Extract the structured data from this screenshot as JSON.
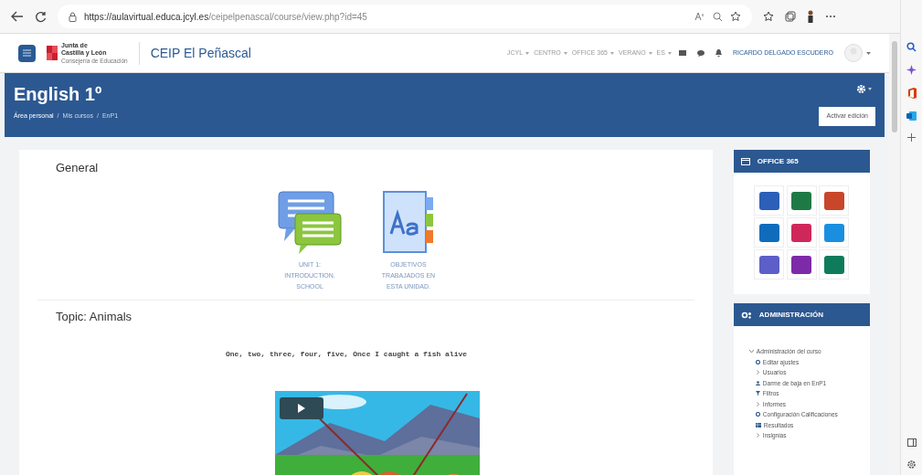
{
  "browser": {
    "url_host": "https://aulavirtual.educa.jcyl.es",
    "url_path": "/ceipelpenascal/course/view.php?id=45"
  },
  "header": {
    "logo_line1": "Junta de",
    "logo_line2": "Castilla y León",
    "logo_line3": "Consejería de Educación",
    "site_name": "CEIP El Peñascal",
    "menus": [
      "JCYL",
      "CENTRO",
      "OFFICE 365",
      "VERANO",
      "ES"
    ],
    "user_name": "RICARDO DELGADO ESCUDERO"
  },
  "course": {
    "title": "English 1º",
    "breadcrumbs": [
      "Área personal",
      "Mis cursos",
      "EnP1"
    ],
    "breadcrumb_separator": "/",
    "edit_button": "Activar edición"
  },
  "sections": [
    {
      "title": "General",
      "activities": [
        {
          "kind": "forum",
          "label": "UNIT 1: INTRODUCTION. SCHOOL"
        },
        {
          "kind": "glossary",
          "label": "OBJETIVOS TRABAJADOS EN ESTA UNIDAD."
        }
      ]
    },
    {
      "title": "Topic: Animals",
      "text": "One, two, three, four, five, Once I caught a fish alive"
    }
  ],
  "blocks": {
    "office": {
      "title": "OFFICE 365",
      "apps": [
        {
          "color": "#2b5fb8"
        },
        {
          "color": "#1e7a45"
        },
        {
          "color": "#c9462b"
        },
        {
          "color": "#0f6cbd"
        },
        {
          "color": "#d0275a"
        },
        {
          "color": "#1a8fe0"
        },
        {
          "color": "#5b5fc7"
        },
        {
          "color": "#7d2aa8"
        },
        {
          "color": "#0e7c5a"
        }
      ]
    },
    "admin": {
      "title": "ADMINISTRACIÓN",
      "tree": {
        "label": "Administración del curso",
        "expanded": true,
        "children": [
          {
            "kind": "gear",
            "label": "Editar ajustes"
          },
          {
            "kind": "branch",
            "label": "Usuarios"
          },
          {
            "kind": "user",
            "label": "Darme de baja en EnP1"
          },
          {
            "kind": "filter",
            "label": "Filtros"
          },
          {
            "kind": "branch",
            "label": "Informes"
          },
          {
            "kind": "gear",
            "label": "Configuración Calificaciones"
          },
          {
            "kind": "table",
            "label": "Resultados"
          },
          {
            "kind": "branch",
            "label": "Insignias"
          }
        ]
      }
    }
  }
}
